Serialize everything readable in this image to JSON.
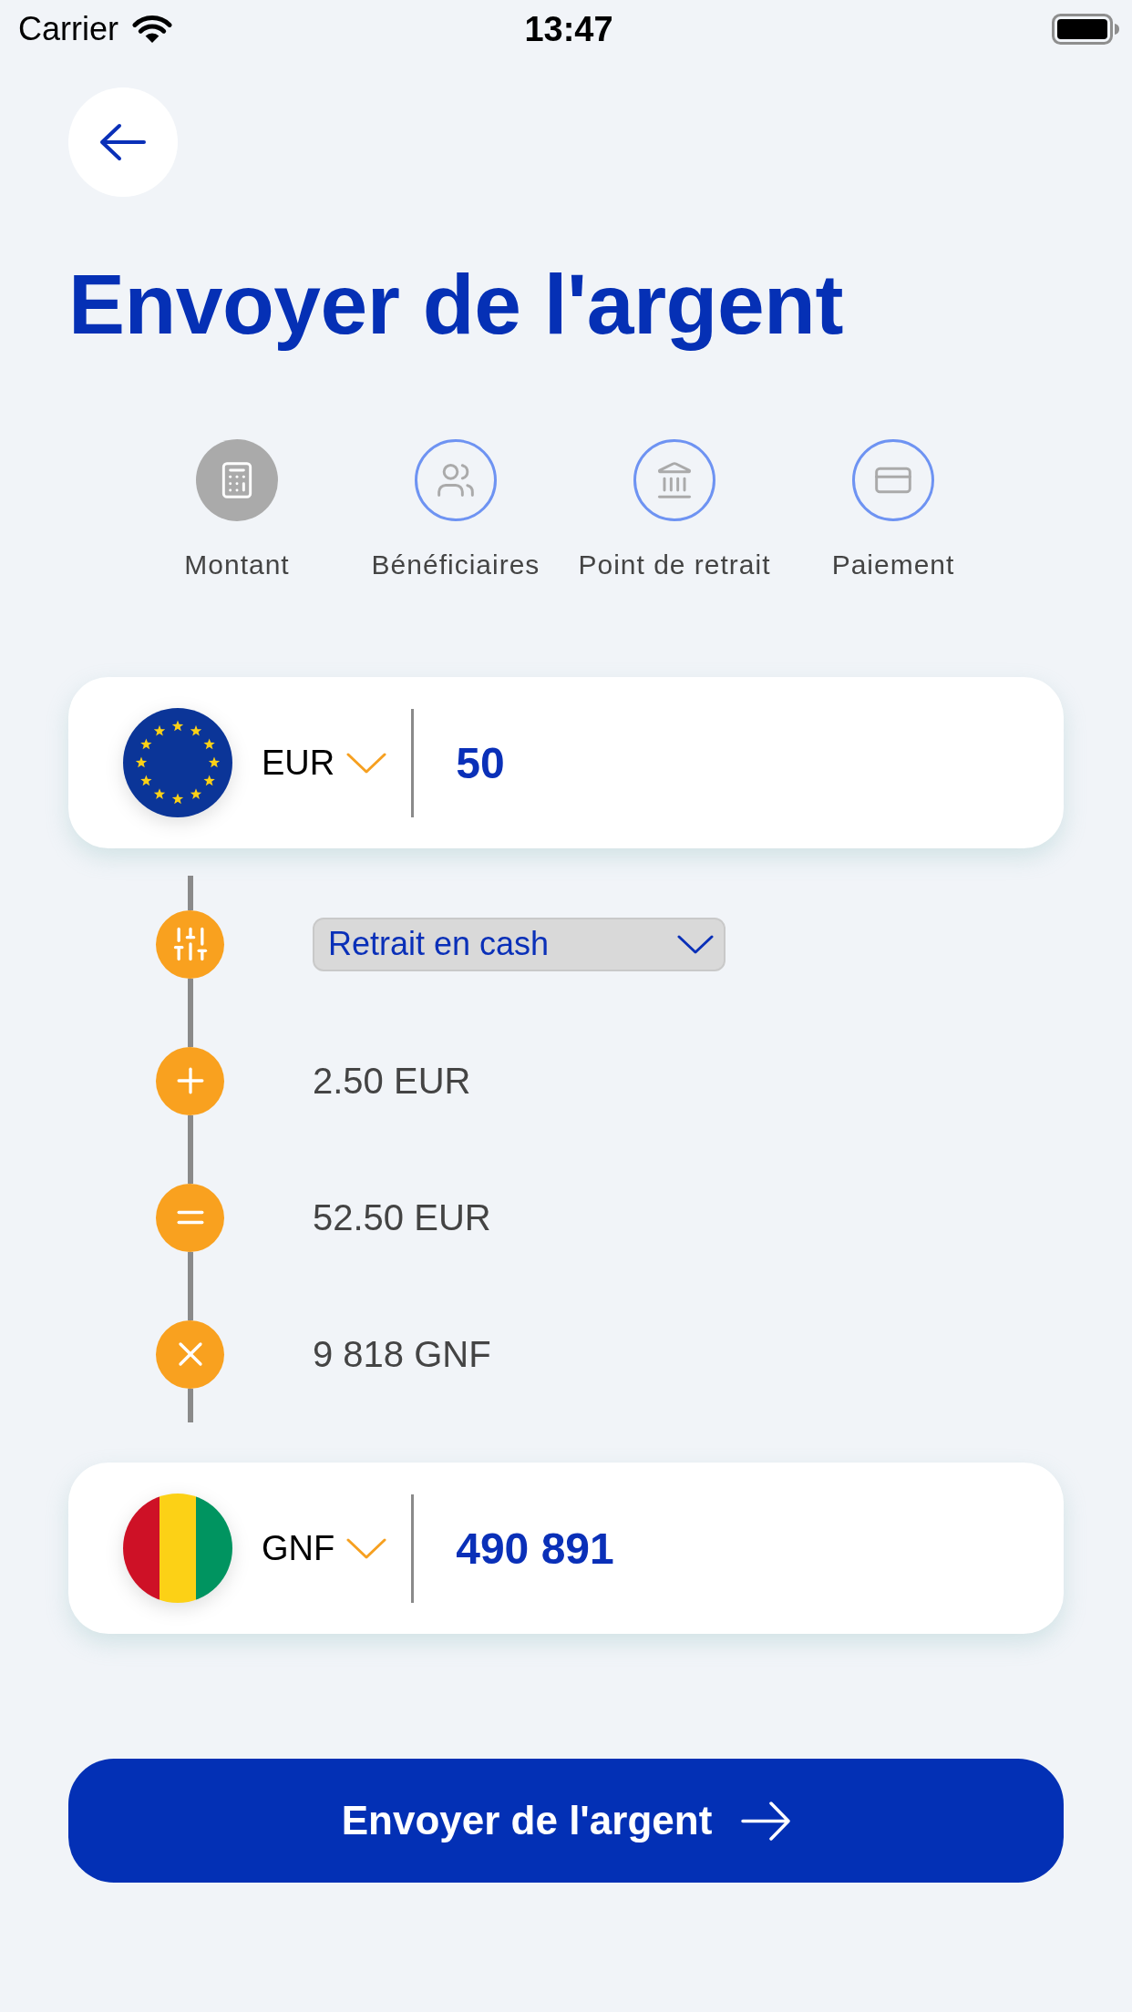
{
  "status_bar": {
    "carrier": "Carrier",
    "time": "13:47"
  },
  "title": "Envoyer de l'argent",
  "steps": [
    {
      "label": "Montant",
      "selected": true
    },
    {
      "label": "Bénéficiaires",
      "selected": false
    },
    {
      "label": "Point de retrait",
      "selected": false
    },
    {
      "label": "Paiement",
      "selected": false
    }
  ],
  "amount_cards": [
    {
      "currency": "EUR",
      "amount": "50"
    },
    {
      "currency": "GNF",
      "amount": "490 891"
    }
  ],
  "breakdown": [
    {
      "kind": "select",
      "value": "Retrait en cash"
    },
    {
      "kind": "text",
      "value": "2.50 EUR"
    },
    {
      "kind": "text",
      "value": "52.50 EUR"
    },
    {
      "kind": "text",
      "value": "9 818 GNF"
    }
  ],
  "submit_button": {
    "label": "Envoyer de l'argent"
  }
}
